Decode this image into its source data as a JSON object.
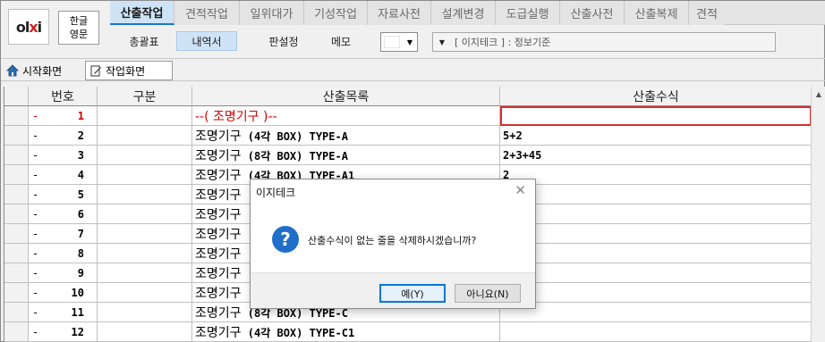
{
  "brand": {
    "logo_text": "olxi"
  },
  "lang_button": {
    "line1": "한글",
    "line2": "영문"
  },
  "tabs": [
    {
      "label": "산출작업",
      "active": true
    },
    {
      "label": "견적작업"
    },
    {
      "label": "일위대가"
    },
    {
      "label": "기성작업"
    },
    {
      "label": "자료사전"
    },
    {
      "label": "설계변경"
    },
    {
      "label": "도급실행"
    },
    {
      "label": "산출사전"
    },
    {
      "label": "산출복제"
    },
    {
      "label": "견적"
    }
  ],
  "subbar": {
    "summary": "총괄표",
    "details": "내역서",
    "spec": "판설정",
    "memo": "메모",
    "color_dropdown_arrow": "▼",
    "standard_dropdown_arrow": "▼",
    "standard_text": "[ 이지테크 ] : 정보기준"
  },
  "page_tabs": {
    "home": "시작화면",
    "work": "작업화면"
  },
  "grid": {
    "headers": [
      "번호",
      "구분",
      "산출목록",
      "산출수식"
    ],
    "rows": [
      {
        "dash": "-",
        "num": "1",
        "name": "--( 조명기구 )--",
        "formula": "",
        "red": true,
        "selected": true
      },
      {
        "dash": "-",
        "num": "2",
        "name_kr": "조명기구",
        "name_spec": " (4각 BOX) TYPE-A",
        "formula": "5+2"
      },
      {
        "dash": "-",
        "num": "3",
        "name_kr": "조명기구",
        "name_spec": " (8각 BOX) TYPE-A",
        "formula": "2+3+45"
      },
      {
        "dash": "-",
        "num": "4",
        "name_kr": "조명기구",
        "name_spec": " (4각 BOX) TYPE-A1",
        "formula": "2"
      },
      {
        "dash": "-",
        "num": "5",
        "name_kr": "조명기구",
        "name_spec": "",
        "formula": ""
      },
      {
        "dash": "-",
        "num": "6",
        "name_kr": "조명기구",
        "name_spec": "",
        "formula": ""
      },
      {
        "dash": "-",
        "num": "7",
        "name_kr": "조명기구",
        "name_spec": "",
        "formula": ""
      },
      {
        "dash": "-",
        "num": "8",
        "name_kr": "조명기구",
        "name_spec": "",
        "formula": ""
      },
      {
        "dash": "-",
        "num": "9",
        "name_kr": "조명기구",
        "name_spec": "",
        "formula": ""
      },
      {
        "dash": "-",
        "num": "10",
        "name_kr": "조명기구",
        "name_spec": "",
        "formula": ""
      },
      {
        "dash": "-",
        "num": "11",
        "name_kr": "조명기구",
        "name_spec": " (8각 BOX) TYPE-C",
        "formula": ""
      },
      {
        "dash": "-",
        "num": "12",
        "name_kr": "조명기구",
        "name_spec": " (4각 BOX) TYPE-C1",
        "formula": ""
      }
    ]
  },
  "dialog": {
    "title": "이지테크",
    "close": "✕",
    "icon": "?",
    "message": "산출수식이 없는 줄을 삭제하시겠습니까?",
    "yes": "예(Y)",
    "no": "아니요(N)"
  },
  "colors": {
    "accent": "#1a75d1",
    "active_tab_bg": "#cfe3f7",
    "error_red": "#d00000",
    "question_icon": "#1f6fc9"
  }
}
